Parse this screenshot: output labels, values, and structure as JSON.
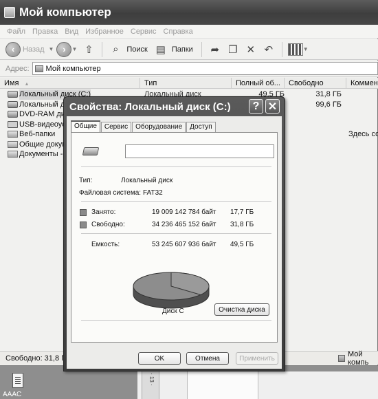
{
  "explorer": {
    "title": "Мой компьютер",
    "menu": [
      "Файл",
      "Правка",
      "Вид",
      "Избранное",
      "Сервис",
      "Справка"
    ],
    "toolbar": {
      "back_label": "Назад",
      "search_label": "Поиск",
      "folders_label": "Папки"
    },
    "address": {
      "label": "Адрес:",
      "value": "Мой компьютер"
    },
    "columns": {
      "name": "Имя",
      "type": "Тип",
      "total": "Полный об...",
      "free": "Свободно",
      "comment": "Коммен"
    },
    "rows": [
      {
        "name": "Локальный диск (C:)",
        "type": "Локальный диск",
        "total": "49,5 ГБ",
        "free": "31,8 ГБ",
        "comment": ""
      },
      {
        "name": "Локальный диск (D:)",
        "type": "",
        "total": "",
        "free": "99,6 ГБ",
        "comment": ""
      },
      {
        "name": "DVD-RAM дисковод",
        "type": "",
        "total": "",
        "free": "",
        "comment": ""
      },
      {
        "name": "USB-видеоустройство",
        "type": "",
        "total": "",
        "free": "",
        "comment": ""
      },
      {
        "name": "Веб-папки",
        "type": "",
        "total": "",
        "free": "",
        "comment": "Здесь со"
      },
      {
        "name": "Общие документы",
        "type": "",
        "total": "",
        "free": "",
        "comment": ""
      },
      {
        "name": "Документы - ",
        "type": "",
        "total": "",
        "free": "",
        "comment": ""
      }
    ],
    "status": {
      "free": "Свободно: 31,8 ГБ",
      "location": "Мой компь"
    }
  },
  "dialog": {
    "title": "Свойства: Локальный диск (С:)",
    "help": "?",
    "close": "✕",
    "tabs": [
      "Общие",
      "Сервис",
      "Оборудование",
      "Доступ"
    ],
    "active_tab": "Общие",
    "label_value": "",
    "type_label": "Тип:",
    "type_value": "Локальный диск",
    "fs_label": "Файловая система:",
    "fs_value": "FAT32",
    "used_label": "Занято:",
    "used_bytes": "19 009 142 784 байт",
    "used_gb": "17,7 ГБ",
    "free_label": "Свободно:",
    "free_bytes": "34 236 465 152 байт",
    "free_gb": "31,8 ГБ",
    "capacity_label": "Емкость:",
    "capacity_bytes": "53 245 607 936 байт",
    "capacity_gb": "49,5 ГБ",
    "disk_label": "Диск С",
    "used_fraction": 0.357,
    "cleanup_label": "Очистка диска",
    "ok_label": "OK",
    "cancel_label": "Отмена",
    "apply_label": "Применить",
    "colors": {
      "used": "#8a8a8a",
      "free": "#8a8a8a"
    }
  },
  "desktop": {
    "icon_label": "AAAC",
    "ruler_text": "· 13 ·"
  }
}
